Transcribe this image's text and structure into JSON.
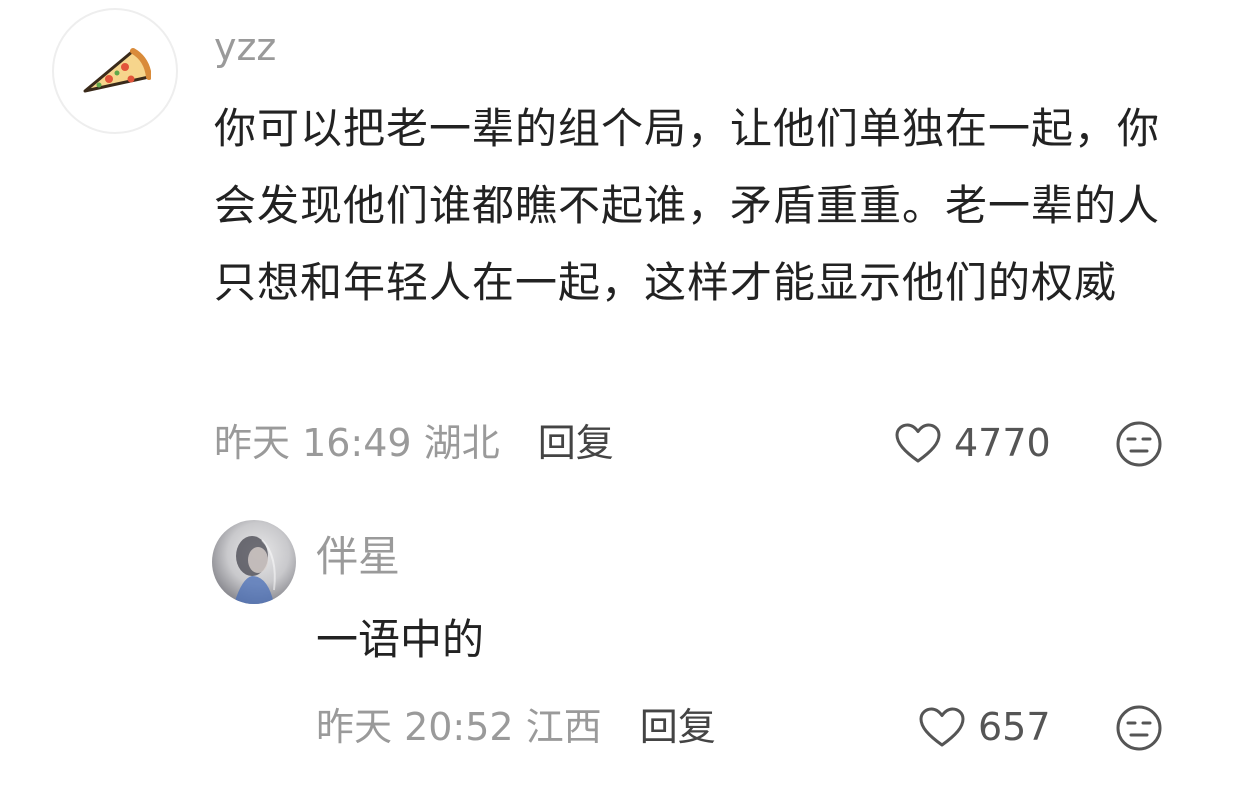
{
  "comment": {
    "username": "yzz",
    "content": "你可以把老一辈的组个局，让他们单独在一起，你会发现他们谁都瞧不起谁，矛盾重重。老一辈的人只想和年轻人在一起，这样才能显示他们的权威",
    "time": "昨天 16:49",
    "location": "湖北",
    "reply_label": "回复",
    "likes": "4770",
    "avatar_icon": "pizza-icon"
  },
  "reply": {
    "username": "伴星",
    "content": "一语中的",
    "time": "昨天 20:52",
    "location": "江西",
    "reply_label": "回复",
    "likes": "657"
  }
}
